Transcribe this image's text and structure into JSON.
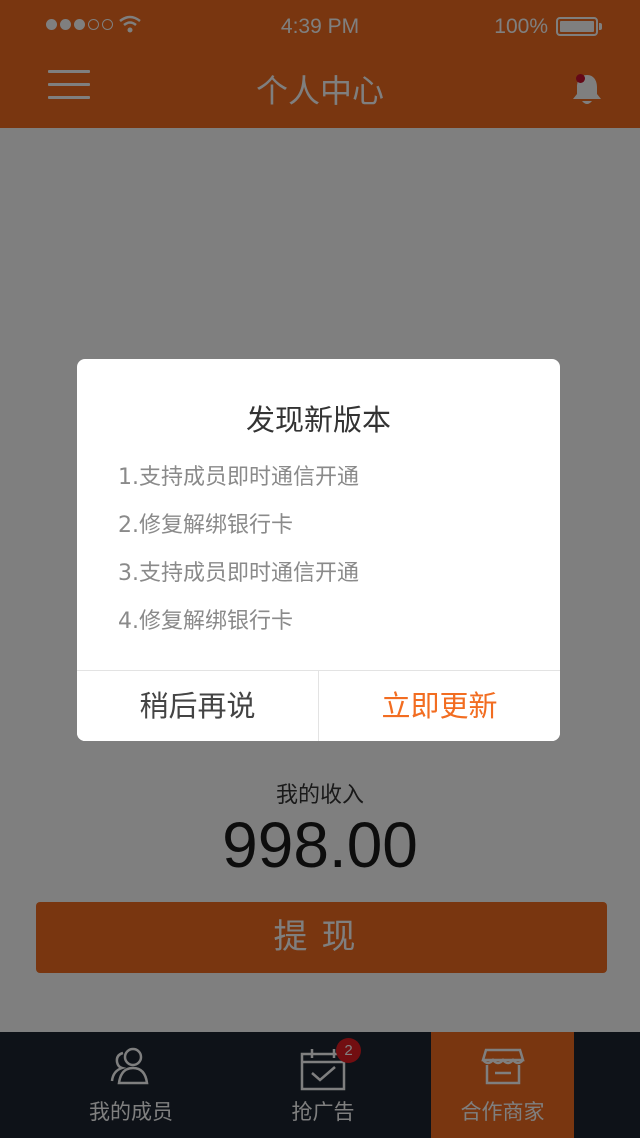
{
  "status_bar": {
    "time": "4:39 PM",
    "battery": "100%"
  },
  "header": {
    "title": "个人中心"
  },
  "income": {
    "label": "我的收入",
    "value": "998.00"
  },
  "withdraw_label": "提现",
  "tabs": [
    {
      "label": "我的成员",
      "icon": "members-icon"
    },
    {
      "label": "抢广告",
      "icon": "calendar-check-icon",
      "badge": "2"
    },
    {
      "label": "合作商家",
      "icon": "store-icon",
      "active": true
    }
  ],
  "dialog": {
    "title": "发现新版本",
    "notes": [
      "1.支持成员即时通信开通",
      "2.修复解绑银行卡",
      "3.支持成员即时通信开通",
      "4.修复解绑银行卡"
    ],
    "later_label": "稍后再说",
    "update_label": "立即更新"
  },
  "colors": {
    "accent": "#f26d21",
    "tabbar": "#1c2530",
    "badge": "#e51c23",
    "overlay": "rgba(0,0,0,0.5)"
  }
}
